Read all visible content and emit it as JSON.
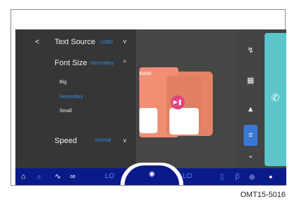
{
  "menu": {
    "back_label": "<",
    "text_source_label": "Text Source",
    "text_source_value": "USB2",
    "text_source_chevron": "v",
    "font_size_label": "Font Size",
    "font_size_value": "Secondary",
    "font_size_chevron": "^",
    "font_size_options": [
      "Big",
      "Secondary",
      "Small"
    ],
    "speed_label": "Speed",
    "speed_value": "Normal",
    "speed_chevron": "v"
  },
  "content": {
    "card_text": "ease"
  },
  "statusbar": {
    "left_temp": "LO",
    "right_temp": "LO"
  },
  "caption": "OMT15-5016",
  "colors": {
    "accent_blue": "#2f8ff0",
    "bar_blue": "#0b1a8a",
    "phone_teal": "#5cc6ca",
    "card_salmon": "#f08f73"
  }
}
